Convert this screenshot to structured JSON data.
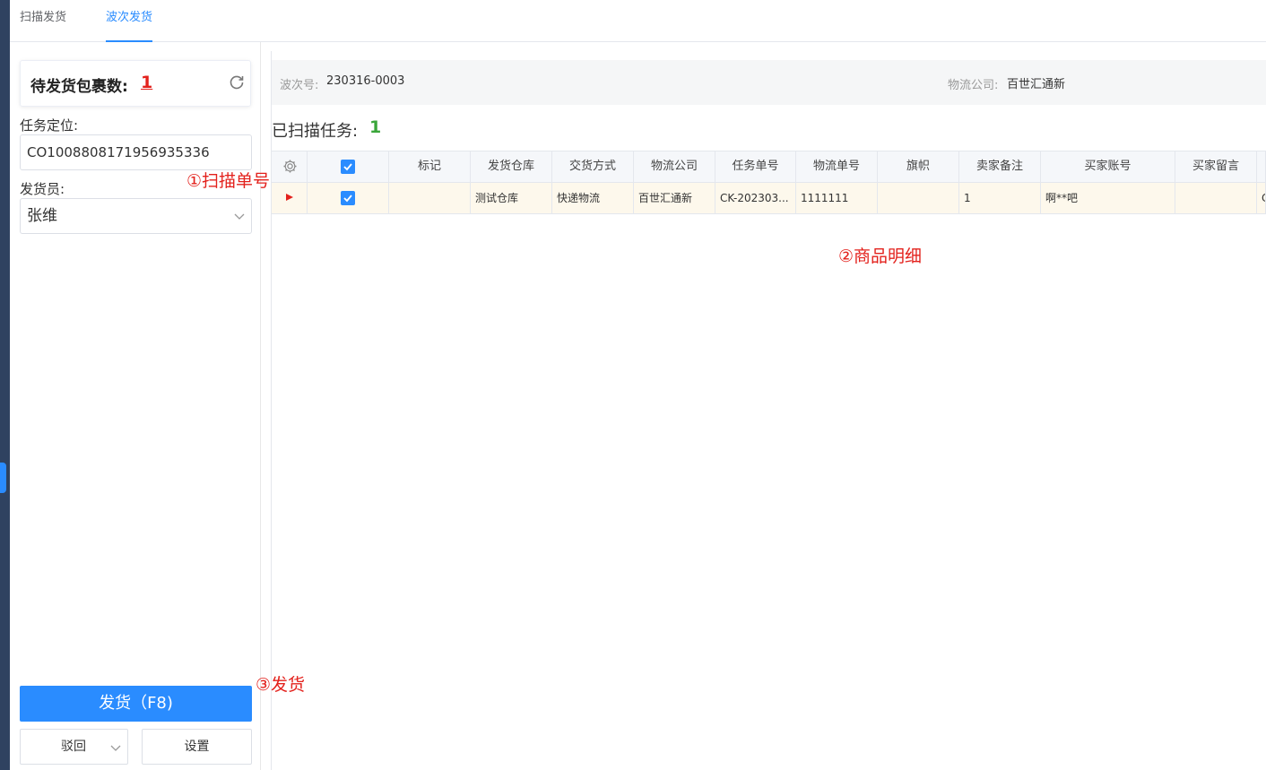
{
  "tabs": [
    {
      "label": "扫描发货",
      "active": false
    },
    {
      "label": "波次发货",
      "active": true
    }
  ],
  "left": {
    "pending_label": "待发货包裹数:",
    "pending_count": "1",
    "task_label": "任务定位:",
    "task_value": "CO1008808171956935336",
    "shipper_label": "发货员:",
    "shipper_value": "张维",
    "ship_button": "发货（F8)",
    "reject_button": "驳回",
    "settings_button": "设置"
  },
  "info": {
    "wave_key": "波次号:",
    "wave_value": "230316-0003",
    "company_key": "物流公司:",
    "company_value": "百世汇通新"
  },
  "scanned": {
    "label": "已扫描任务:",
    "value": "1"
  },
  "table": {
    "headers": [
      "",
      "",
      "标记",
      "发货仓库",
      "交货方式",
      "物流公司",
      "任务单号",
      "物流单号",
      "旗帜",
      "卖家备注",
      "买家账号",
      "买家留言",
      ""
    ],
    "rows": [
      {
        "cells": [
          "",
          "",
          "",
          "测试仓库",
          "快递物流",
          "百世汇通新",
          "CK-202303...",
          "1111111",
          "",
          "1",
          "啊**吧",
          "",
          "C"
        ],
        "selected": true,
        "checked": true
      }
    ]
  },
  "annotations": {
    "scan": "①扫描单号",
    "detail": "②商品明细",
    "ship": "③发货"
  },
  "colors": {
    "accent": "#2a8cff",
    "annotation": "#e3211c",
    "scanned_count": "#3aa63a",
    "sidebar": "#2f4260"
  },
  "icons": [
    "refresh-icon",
    "chevron-down-icon",
    "gear-icon",
    "checkbox-icon",
    "row-expand-icon"
  ]
}
